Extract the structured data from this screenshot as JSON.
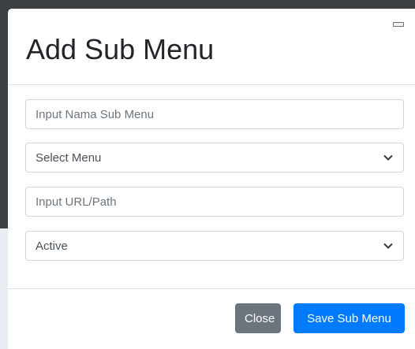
{
  "modal": {
    "title": "Add Sub Menu",
    "close_icon": "minimize-icon"
  },
  "form": {
    "sub_menu_name": {
      "value": "",
      "placeholder": "Input Nama Sub Menu"
    },
    "menu_select": {
      "selected": "Select Menu",
      "icon": "chevron-down-icon"
    },
    "url_path": {
      "value": "",
      "placeholder": "Input URL/Path"
    },
    "status_select": {
      "selected": "Active",
      "icon": "chevron-down-icon"
    }
  },
  "footer": {
    "close_label": "Close",
    "save_label": "Save Sub Menu"
  },
  "colors": {
    "primary": "#007bff",
    "secondary": "#6c757d",
    "border": "#ced4da",
    "title": "#212529"
  }
}
